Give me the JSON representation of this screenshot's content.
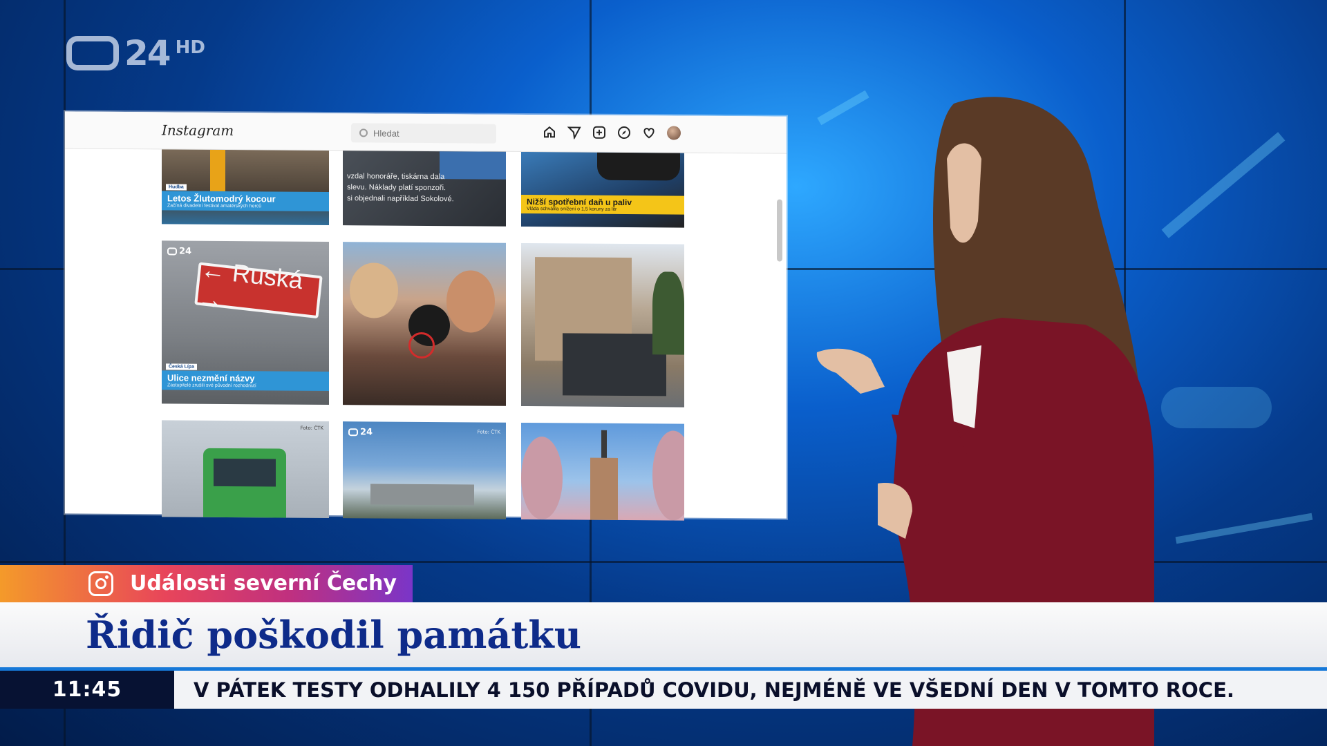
{
  "channel": {
    "logo_number": "24",
    "logo_suffix": "HD"
  },
  "instagram": {
    "brand": "Instagram",
    "search_placeholder": "Hledat",
    "nav_icons": [
      "home-icon",
      "direct-icon",
      "new-post-icon",
      "explore-icon",
      "activity-heart-icon",
      "profile-avatar"
    ],
    "posts": [
      {
        "tag": "Hudba",
        "title": "Letos Žlutomodrý kocour",
        "subtitle": "Začíná divadelní festival amatérských herců"
      },
      {
        "text_lines": [
          "vzdal honoráře, tiskárna dala",
          "slevu. Náklady platí sponzoři.",
          "si objednali například Sokolové."
        ]
      },
      {
        "title": "Nižší spotřební daň u paliv",
        "subtitle": "Vláda schválila snížení o 1,5 koruny za litr"
      },
      {
        "logo": "24",
        "sign_text": "← Ruská →",
        "tag": "Česká Lípa",
        "title": "Ulice nezmění názvy",
        "subtitle": "Zastupitelé zrušili své původní rozhodnutí"
      },
      {
        "description": "photo"
      },
      {
        "description": "photo"
      },
      {
        "credit": "Foto: ČTK"
      },
      {
        "logo": "24",
        "credit": "Foto: ČTK"
      },
      {
        "description": "photo"
      }
    ]
  },
  "lower_third": {
    "source_label": "Události severní Čechy",
    "headline": "Řidič poškodil památku",
    "ticker_time": "11:45",
    "ticker_text": "V PÁTEK TESTY ODHALILY 4 150 PŘÍPADŮ COVIDU, NEJMÉNĚ VE VŠEDNÍ DEN V TOMTO ROCE."
  },
  "colors": {
    "headline_text": "#0e2b8a",
    "ticker_accent": "#1678d8",
    "time_box": "#071233",
    "source_gradient": [
      "#f49a2a",
      "#e8455a",
      "#c0307f",
      "#7a35c8"
    ]
  }
}
